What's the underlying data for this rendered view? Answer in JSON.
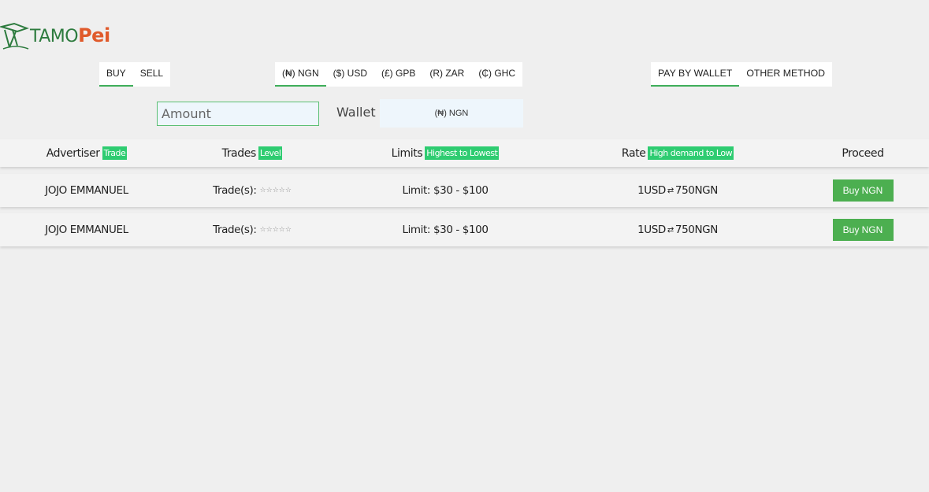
{
  "logo": {
    "text_a": "TAMO",
    "text_b": "Pei"
  },
  "direction_tabs": [
    {
      "label": "BUY",
      "active": true
    },
    {
      "label": "SELL",
      "active": false
    }
  ],
  "currency_tabs": [
    {
      "label": "(₦) NGN",
      "active": true
    },
    {
      "label": "($) USD",
      "active": false
    },
    {
      "label": "(£) GPB",
      "active": false
    },
    {
      "label": "(R) ZAR",
      "active": false
    },
    {
      "label": "(₵) GHC",
      "active": false
    }
  ],
  "payment_tabs": [
    {
      "label": "PAY BY WALLET",
      "active": true
    },
    {
      "label": "OTHER METHOD",
      "active": false
    }
  ],
  "amount": {
    "placeholder": "Amount",
    "value": ""
  },
  "wallet": {
    "label": "Wallet",
    "selected": "(₦) NGN"
  },
  "table": {
    "headers": {
      "advertiser": "Advertiser",
      "advertiser_badge": "Trade",
      "trades": "Trades",
      "trades_badge": "Level",
      "limits": "Limits",
      "limits_badge": "Highest to Lowest",
      "rate": "Rate",
      "rate_badge": "High demand to Low",
      "proceed": "Proceed"
    },
    "rows": [
      {
        "advertiser": "JOJO EMMANUEL",
        "trades": "Trade(s):",
        "stars": "☆☆☆☆☆",
        "limit": "Limit: $30 - $100",
        "rate_from": "1USD",
        "rate_swap": "⇄",
        "rate_to": "750NGN",
        "action": "Buy NGN"
      },
      {
        "advertiser": "JOJO EMMANUEL",
        "trades": "Trade(s):",
        "stars": "☆☆☆☆☆",
        "limit": "Limit: $30 - $100",
        "rate_from": "1USD",
        "rate_swap": "⇄",
        "rate_to": "750NGN",
        "action": "Buy NGN"
      }
    ]
  },
  "colors": {
    "accent": "#3fae5a",
    "badge": "#2ecc71",
    "button": "#4caf50",
    "logo_green": "#2d7b3e",
    "logo_orange": "#e05a2b"
  }
}
